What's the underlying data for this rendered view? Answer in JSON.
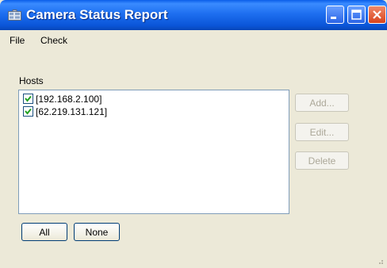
{
  "window": {
    "title": "Camera Status Report",
    "icon": "camera-app-icon"
  },
  "titlebar_buttons": [
    "minimize",
    "maximize",
    "close"
  ],
  "menu": [
    {
      "label": "File"
    },
    {
      "label": "Check"
    }
  ],
  "hosts": {
    "label": "Hosts",
    "items": [
      {
        "text": "[192.168.2.100]",
        "checked": true
      },
      {
        "text": "[62.219.131.121]",
        "checked": true
      }
    ]
  },
  "buttons": {
    "add": {
      "label": "Add...",
      "enabled": false
    },
    "edit": {
      "label": "Edit...",
      "enabled": false
    },
    "delete": {
      "label": "Delete",
      "enabled": false
    },
    "all": {
      "label": "All",
      "enabled": true
    },
    "none": {
      "label": "None",
      "enabled": true
    }
  },
  "colors": {
    "titlebar": "#0a5ee9",
    "face": "#ece9d8",
    "list_border": "#7f9db9",
    "disabled_text": "#aca899"
  }
}
